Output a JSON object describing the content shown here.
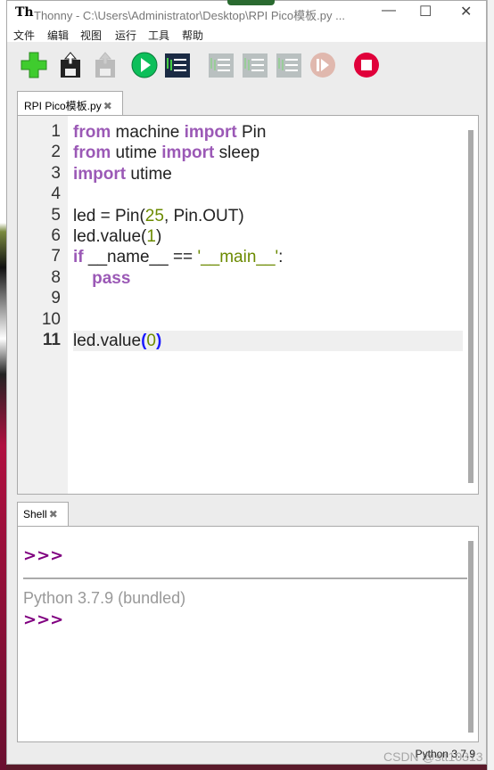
{
  "window": {
    "title": "Thonny  -  C:\\Users\\Administrator\\Desktop\\RPI Pico模板.py  ...",
    "logo": "Th",
    "minimize": "—",
    "maximize": "☐",
    "close": "✕"
  },
  "menu": [
    "文件",
    "编辑",
    "视图",
    "运行",
    "工具",
    "帮助"
  ],
  "toolbar": [
    {
      "name": "new-file-icon",
      "color": "#3fcc2e",
      "enabled": true
    },
    {
      "name": "save-file-icon",
      "color": "#222222",
      "enabled": true
    },
    {
      "name": "load-file-icon",
      "color": "#bbbbbb",
      "enabled": false
    },
    {
      "name": "run-icon",
      "color": "#0dbf5a",
      "enabled": true
    },
    {
      "name": "debug-icon",
      "color": "#1b2b44",
      "enabled": true
    },
    {
      "name": "step-over-icon",
      "color": "#b9c0c0",
      "enabled": false
    },
    {
      "name": "step-into-icon",
      "color": "#b9c0c0",
      "enabled": false
    },
    {
      "name": "step-out-icon",
      "color": "#b9c0c0",
      "enabled": false
    },
    {
      "name": "resume-icon",
      "color": "#e0b8ae",
      "enabled": false
    },
    {
      "name": "stop-icon",
      "color": "#e0003a",
      "enabled": true
    }
  ],
  "editor": {
    "tab_label": "RPI Pico模板.py",
    "tab_close": "✖",
    "current_line": 11,
    "lines": [
      [
        [
          "from",
          "kw"
        ],
        [
          " machine ",
          ""
        ],
        [
          "import",
          "kw"
        ],
        [
          " Pin",
          ""
        ]
      ],
      [
        [
          "from",
          "kw"
        ],
        [
          " utime ",
          ""
        ],
        [
          "import",
          "kw"
        ],
        [
          " sleep",
          ""
        ]
      ],
      [
        [
          "import",
          "kw"
        ],
        [
          " utime",
          ""
        ]
      ],
      [],
      [
        [
          "led = Pin(",
          ""
        ],
        [
          "25",
          "num"
        ],
        [
          ", Pin.OUT)",
          ""
        ]
      ],
      [
        [
          "led.value(",
          ""
        ],
        [
          "1",
          "num"
        ],
        [
          ")",
          ""
        ]
      ],
      [
        [
          "if",
          "kw"
        ],
        [
          " __name__ == ",
          ""
        ],
        [
          "'__main__'",
          "str"
        ],
        [
          ":",
          ""
        ]
      ],
      [
        [
          "    ",
          ""
        ],
        [
          "pass",
          "kw"
        ]
      ],
      [],
      [],
      [
        [
          "led.value",
          ""
        ],
        [
          "(",
          "par"
        ],
        [
          "0",
          "num"
        ],
        [
          ")",
          "par"
        ]
      ]
    ]
  },
  "shell": {
    "tab_label": "Shell",
    "tab_close": "✖",
    "prompt1": ">>>",
    "version": "Python 3.7.9 (bundled)",
    "prompt2": ">>>"
  },
  "status": "Python 3.7.9",
  "watermark": "CSDN @stt10313"
}
